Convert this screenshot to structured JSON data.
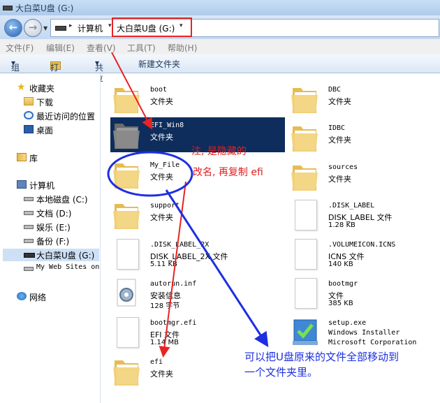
{
  "window": {
    "title": "大白菜U盘 (G:)"
  },
  "address": {
    "segments": [
      "计算机",
      "大白菜U盘 (G:)"
    ]
  },
  "menu": [
    "文件(F)",
    "编辑(E)",
    "查看(V)",
    "工具(T)",
    "帮助(H)"
  ],
  "toolbar": {
    "organize": "组织",
    "open": "打开",
    "share": "共享",
    "new_folder": "新建文件夹"
  },
  "sidebar": {
    "favorites": "收藏夹",
    "downloads": "下载",
    "recent": "最近访问的位置",
    "desktop": "桌面",
    "libraries": "库",
    "computer": "计算机",
    "drives": [
      "本地磁盘 (C:)",
      "文档 (D:)",
      "娱乐 (E:)",
      "备份 (F:)",
      "大白菜U盘 (G:)",
      "My Web Sites on"
    ],
    "network": "网络"
  },
  "files": [
    {
      "name": "boot",
      "type": "文件夹"
    },
    {
      "name": "DBC",
      "type": "文件夹"
    },
    {
      "name": "EFI_Win8",
      "type": "文件夹"
    },
    {
      "name": "IDBC",
      "type": "文件夹"
    },
    {
      "name": "My_File",
      "type": "文件夹"
    },
    {
      "name": "sources",
      "type": "文件夹"
    },
    {
      "name": "support",
      "type": "文件夹"
    },
    {
      "name": ".DISK_LABEL",
      "type": "DISK_LABEL 文件",
      "size": "1.28 KB"
    },
    {
      "name": ".DISK_LABEL_2X",
      "type": "DISK_LABEL_2X 文件",
      "size": "5.11 KB"
    },
    {
      "name": ".VOLUMEICON.ICNS",
      "type": "ICNS 文件",
      "size": "140 KB"
    },
    {
      "name": "autorun.inf",
      "type": "安装信息",
      "size": "128 字节"
    },
    {
      "name": "bootmgr",
      "type": "文件",
      "size": "385 KB"
    },
    {
      "name": "bootmgr.efi",
      "type": "EFI 文件",
      "size": "1.14 MB"
    },
    {
      "name": "setup.exe",
      "type": "Windows Installer",
      "size": "Microsoft Corporation"
    },
    {
      "name": "efi",
      "type": "文件夹"
    }
  ],
  "annotations": {
    "note_red_1": "注, 是隐藏的",
    "note_red_2": "改名, 再复制 efi",
    "note_blue_1": "可以把U盘原来的文件全部移动到",
    "note_blue_2": "一个文件夹里。",
    "color_red": "#e82323",
    "color_blue": "#1d2fe0"
  }
}
